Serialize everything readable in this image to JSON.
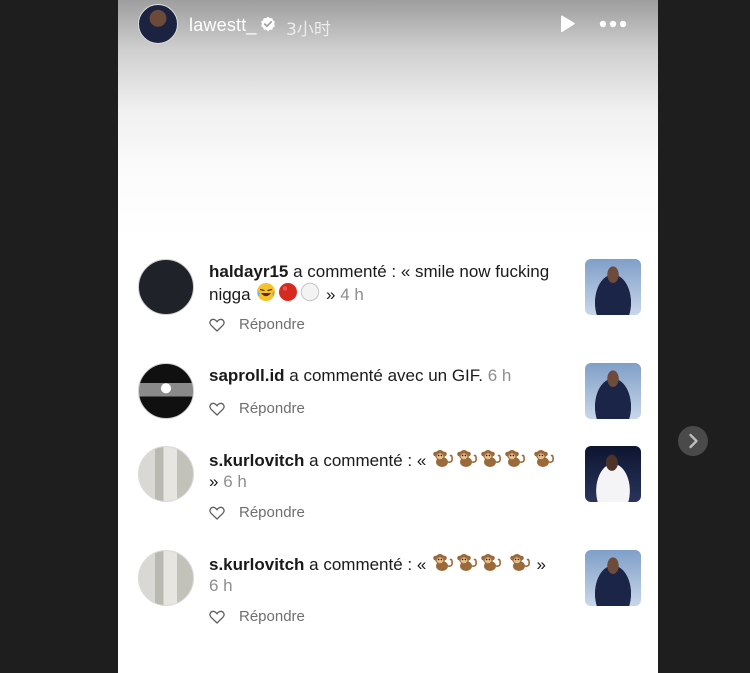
{
  "header": {
    "username": "lawestt_",
    "time_ago": "3小时",
    "icons": [
      "verified-badge-icon",
      "play-icon",
      "more-icon"
    ]
  },
  "comments": [
    {
      "username": "haldayr15",
      "text": " a commenté : « smile now fucking nigga ",
      "emojis": [
        "laughing-emoji",
        "red-circle-emoji",
        "white-circle-emoji"
      ],
      "suffix": " » ",
      "time": "4 h",
      "reply_label": "Répondre"
    },
    {
      "username": "saproll.id",
      "text": " a commenté avec un GIF. ",
      "emojis": [],
      "suffix": "",
      "time": "6 h",
      "reply_label": "Répondre"
    },
    {
      "username": "s.kurlovitch",
      "text": " a commenté : « ",
      "emojis": [
        "monkey-emoji",
        "monkey-emoji",
        "monkey-emoji",
        "monkey-emoji",
        "monkey-emoji"
      ],
      "suffix": " » ",
      "time": "6 h",
      "reply_label": "Répondre"
    },
    {
      "username": "s.kurlovitch",
      "text": " a commenté : « ",
      "emojis": [
        "monkey-emoji",
        "monkey-emoji",
        "monkey-emoji",
        "monkey-emoji"
      ],
      "suffix": " » ",
      "time": "6 h",
      "reply_label": "Répondre"
    }
  ],
  "colors": {
    "page_bg": "#1e1e1e",
    "story_bg": "#ffffff",
    "secondary_text": "#8e8e8e"
  }
}
